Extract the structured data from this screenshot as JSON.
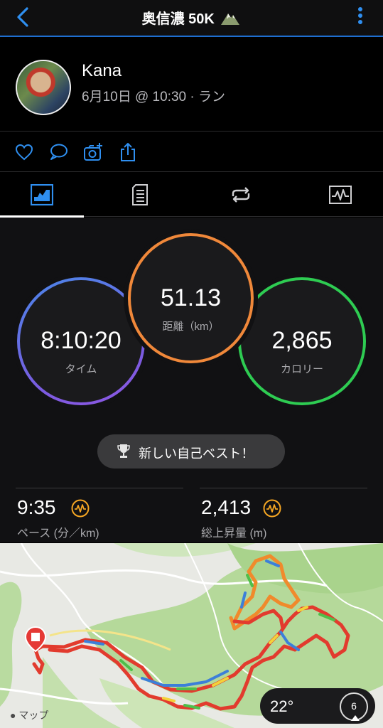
{
  "header": {
    "title": "奥信濃 50K"
  },
  "profile": {
    "name": "Kana",
    "meta": "6月10日 @ 10:30 · ラン"
  },
  "stats": {
    "time": {
      "value": "8:10:20",
      "label": "タイム"
    },
    "distance": {
      "value": "51.13",
      "label": "距離（km）"
    },
    "calories": {
      "value": "2,865",
      "label": "カロリー"
    },
    "pr_label": "新しい自己ベスト！",
    "pace": {
      "value": "9:35",
      "label": "ペース (分／km)"
    },
    "ascent": {
      "value": "2,413",
      "label": "総上昇量 (m)"
    }
  },
  "map": {
    "attribution": "マップ",
    "temperature": "22°",
    "wind": "6"
  },
  "colors": {
    "accent": "#2f8ff0",
    "time_ring": "#6f62e3",
    "distance_ring": "#f0883a",
    "calories_ring": "#2ecc52",
    "badge_orange": "#f5a623"
  }
}
